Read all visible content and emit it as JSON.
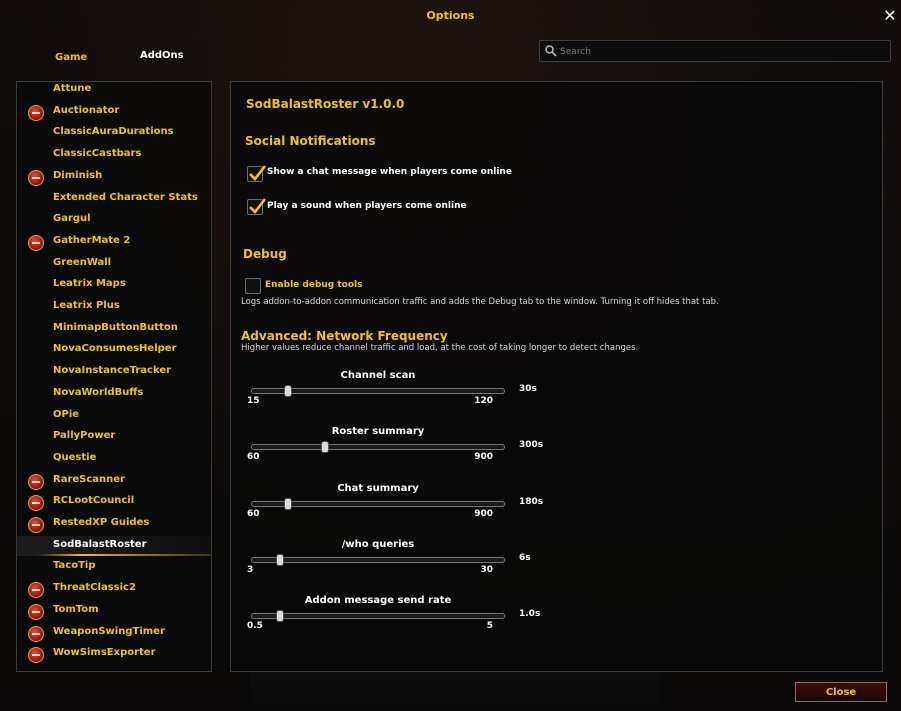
{
  "window": {
    "title": "Options",
    "close_symbol": "✕"
  },
  "tabs": [
    {
      "label": "Game"
    },
    {
      "label": "AddOns"
    }
  ],
  "search": {
    "placeholder": "Search",
    "value": ""
  },
  "addon_list": [
    {
      "label": "Attune",
      "collapsible": false
    },
    {
      "label": "Auctionator",
      "collapsible": true
    },
    {
      "label": "ClassicAuraDurations",
      "collapsible": false
    },
    {
      "label": "ClassicCastbars",
      "collapsible": false
    },
    {
      "label": "Diminish",
      "collapsible": true
    },
    {
      "label": "Extended Character Stats",
      "collapsible": false
    },
    {
      "label": "Gargul",
      "collapsible": false
    },
    {
      "label": "GatherMate 2",
      "collapsible": true
    },
    {
      "label": "GreenWall",
      "collapsible": false
    },
    {
      "label": "Leatrix Maps",
      "collapsible": false
    },
    {
      "label": "Leatrix Plus",
      "collapsible": false
    },
    {
      "label": "MinimapButtonButton",
      "collapsible": false
    },
    {
      "label": "NovaConsumesHelper",
      "collapsible": false
    },
    {
      "label": "NovaInstanceTracker",
      "collapsible": false
    },
    {
      "label": "NovaWorldBuffs",
      "collapsible": false
    },
    {
      "label": "OPie",
      "collapsible": false
    },
    {
      "label": "PallyPower",
      "collapsible": false
    },
    {
      "label": "Questie",
      "collapsible": false
    },
    {
      "label": "RareScanner",
      "collapsible": true
    },
    {
      "label": "RCLootCouncil",
      "collapsible": true
    },
    {
      "label": "RestedXP Guides",
      "collapsible": true
    },
    {
      "label": "SodBalastRoster",
      "collapsible": false,
      "selected": true
    },
    {
      "label": "TacoTip",
      "collapsible": false
    },
    {
      "label": "ThreatClassic2",
      "collapsible": true
    },
    {
      "label": "TomTom",
      "collapsible": true
    },
    {
      "label": "WeaponSwingTimer",
      "collapsible": true
    },
    {
      "label": "WowSimsExporter",
      "collapsible": true
    }
  ],
  "panel": {
    "addon_title": "SodBalastRoster v1.0.0",
    "social": {
      "heading": "Social Notifications",
      "options": [
        {
          "label": "Show a chat message when players come online",
          "checked": true
        },
        {
          "label": "Play a sound when players come online",
          "checked": true
        }
      ]
    },
    "debug": {
      "heading": "Debug",
      "option": {
        "label": "Enable debug tools",
        "checked": false
      },
      "description": "Logs addon-to-addon communication traffic and adds the Debug tab to the window. Turning it off hides that tab."
    },
    "advanced": {
      "heading": "Advanced: Network Frequency",
      "description": "Higher values reduce channel traffic and load, at the cost of taking longer to detect changes.",
      "sliders": [
        {
          "title": "Channel scan",
          "min_label": "15",
          "max_label": "120",
          "value_label": "30s",
          "min": 15,
          "max": 120,
          "value": 30
        },
        {
          "title": "Roster summary",
          "min_label": "60",
          "max_label": "900",
          "value_label": "300s",
          "min": 60,
          "max": 900,
          "value": 300
        },
        {
          "title": "Chat summary",
          "min_label": "60",
          "max_label": "900",
          "value_label": "180s",
          "min": 60,
          "max": 900,
          "value": 180
        },
        {
          "title": "/who queries",
          "min_label": "3",
          "max_label": "30",
          "value_label": "6s",
          "min": 3,
          "max": 30,
          "value": 6
        },
        {
          "title": "Addon message send rate",
          "min_label": "0.5",
          "max_label": "5",
          "value_label": "1.0s",
          "min": 0.5,
          "max": 5,
          "value": 1.0
        }
      ]
    }
  },
  "footer": {
    "close_label": "Close"
  },
  "colors": {
    "accent": "#f2c21b",
    "panel_bg": "#0a0a0a",
    "selected_highlight": "#e6be28"
  }
}
